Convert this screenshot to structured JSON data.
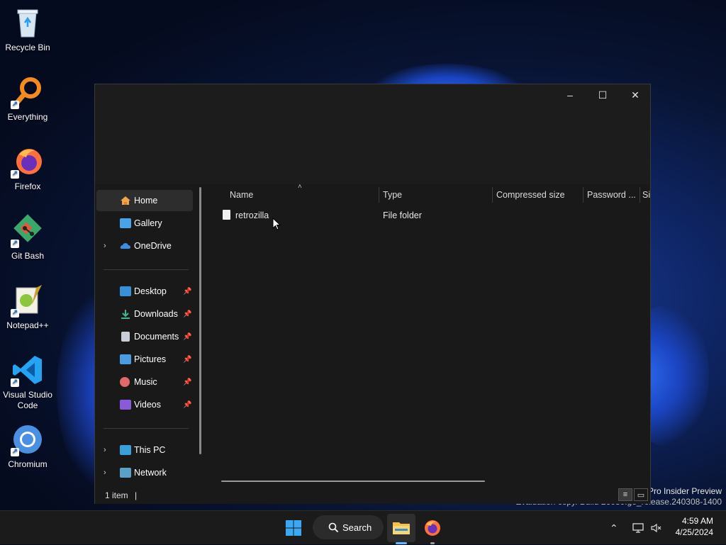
{
  "desktop": {
    "icons": [
      {
        "label": "Recycle Bin",
        "icon": "recycle-bin-icon"
      },
      {
        "label": "Everything",
        "icon": "everything-search-icon"
      },
      {
        "label": "Firefox",
        "icon": "firefox-icon"
      },
      {
        "label": "Git Bash",
        "icon": "git-bash-icon"
      },
      {
        "label": "Notepad++",
        "icon": "notepad-plus-plus-icon"
      },
      {
        "label": "Visual Studio Code",
        "icon": "vscode-icon"
      },
      {
        "label": "Chromium",
        "icon": "chromium-icon"
      }
    ]
  },
  "window": {
    "controls": {
      "minimize": "–",
      "maximize": "☐",
      "close": "✕"
    },
    "sidebar": {
      "items": [
        {
          "label": "Home",
          "icon": "home-icon",
          "selected": true
        },
        {
          "label": "Gallery",
          "icon": "gallery-icon"
        },
        {
          "label": "OneDrive",
          "icon": "onedrive-icon",
          "expandable": true
        },
        {
          "label": "Desktop",
          "icon": "desktop-folder-icon",
          "pinned": true
        },
        {
          "label": "Downloads",
          "icon": "downloads-folder-icon",
          "pinned": true
        },
        {
          "label": "Documents",
          "icon": "documents-folder-icon",
          "pinned": true
        },
        {
          "label": "Pictures",
          "icon": "pictures-folder-icon",
          "pinned": true
        },
        {
          "label": "Music",
          "icon": "music-folder-icon",
          "pinned": true
        },
        {
          "label": "Videos",
          "icon": "videos-folder-icon",
          "pinned": true
        },
        {
          "label": "This PC",
          "icon": "this-pc-icon",
          "expandable": true
        },
        {
          "label": "Network",
          "icon": "network-icon",
          "expandable": true
        }
      ]
    },
    "columns": [
      "Name",
      "Type",
      "Compressed size",
      "Password ...",
      "Si"
    ],
    "files": [
      {
        "name": "retrozilla",
        "type": "File folder",
        "icon": "file-icon"
      }
    ],
    "status": {
      "count": "1 item",
      "separator": "|"
    }
  },
  "watermark": {
    "line1": "Pro Insider Preview",
    "line2": "Evaluation copy. Build 26080.ge_release.240308-1400"
  },
  "taskbar": {
    "search_label": "Search",
    "time": "4:59 AM",
    "date": "4/25/2024"
  },
  "colors": {
    "accent": "#0078d4",
    "folder_yellow": "#f2c14e"
  }
}
